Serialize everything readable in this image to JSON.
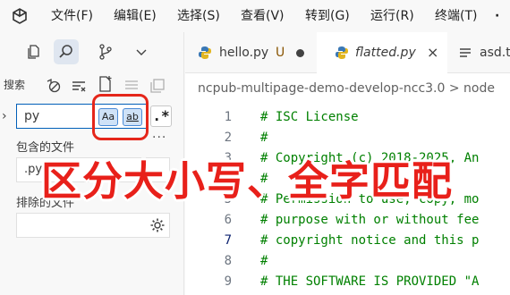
{
  "menubar": {
    "items": [
      "文件(F)",
      "编辑(E)",
      "选择(S)",
      "查看(V)",
      "转到(G)",
      "运行(R)",
      "终端(T)",
      "·"
    ]
  },
  "sidebar": {
    "search_title": "搜索",
    "search": {
      "value": "py",
      "match_case_label": "Aa",
      "whole_word_label": "ab",
      "regex_label": ".*"
    },
    "more": "···",
    "include": {
      "label": "包含的文件",
      "value": ".py"
    },
    "exclude": {
      "label": "排除的文件",
      "value": ""
    }
  },
  "editor": {
    "tabs": [
      {
        "name": "hello.py",
        "badge": "U"
      },
      {
        "name": "flatted.py",
        "close": "×"
      },
      {
        "name": "asd.t"
      }
    ],
    "breadcrumb": "ncpub-multipage-demo-develop-ncc3.0  >  node",
    "lines": [
      {
        "num": "1",
        "text": "# ISC License"
      },
      {
        "num": "2",
        "text": "#"
      },
      {
        "num": "3",
        "text": "# Copyright (c) 2018-2025, An"
      },
      {
        "num": "4",
        "text": "#"
      },
      {
        "num": "5",
        "text": "# Permission to use, copy, mo"
      },
      {
        "num": "6",
        "text": "# purpose with or without fee"
      },
      {
        "num": "7",
        "text": "# copyright notice and this p"
      },
      {
        "num": "8",
        "text": "#"
      },
      {
        "num": "9",
        "text": "# THE SOFTWARE IS PROVIDED \"A"
      }
    ]
  },
  "overlay_caption": "区分大小写、全字匹配",
  "colors": {
    "accent": "#005fb8",
    "highlight_red": "#e5261a",
    "comment_green": "#008000"
  }
}
